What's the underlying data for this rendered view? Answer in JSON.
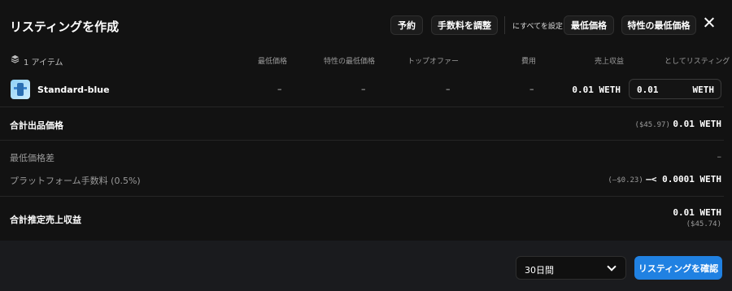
{
  "header": {
    "title": "リスティングを作成",
    "btn_reserve": "予約",
    "btn_adjust_fee": "手数料を調整",
    "set_all_label": "にすべてを設定",
    "btn_floor_price": "最低価格",
    "btn_trait_floor": "特性の最低価格"
  },
  "table": {
    "item_count": "1 アイテム",
    "columns": [
      "最低価格",
      "特性の最低価格",
      "トップオファー",
      "費用",
      "売上収益",
      "としてリスティング"
    ],
    "row": {
      "name": "Standard-blue",
      "floor": "–",
      "trait_floor": "–",
      "top_offer": "–",
      "cost": "–",
      "proceeds": "0.01 WETH",
      "list_value": "0.01",
      "list_currency": "WETH"
    }
  },
  "summary": {
    "total_label": "合計出品価格",
    "total_usd": "($45.97)",
    "total_value": "0.01 WETH",
    "floor_diff_label": "最低価格差",
    "floor_diff_value": "–",
    "platform_fee_label": "プラットフォーム手数料 (0.5%)",
    "platform_fee_usd": "(–$0.23)",
    "platform_fee_value": "–< 0.0001 WETH",
    "est_label": "合計推定売上収益",
    "est_value": "0.01 WETH",
    "est_usd": "($45.74)"
  },
  "footer": {
    "duration": "30日間",
    "confirm": "リスティングを確認"
  },
  "colors": {
    "accent": "#2081e2",
    "background": "#121212",
    "footer": "#1a1b1e"
  }
}
